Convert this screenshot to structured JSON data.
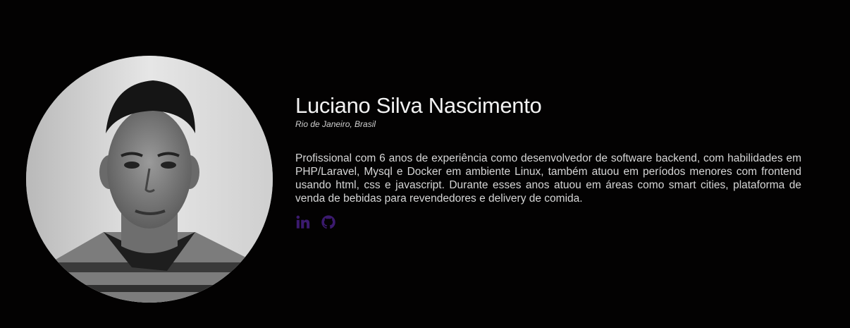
{
  "profile": {
    "name": "Luciano Silva Nascimento",
    "location": "Rio de Janeiro, Brasil",
    "bio": "Profissional com 6 anos de experiência como desenvolvedor de software backend, com habilidades em PHP/Laravel, Mysql e Docker em ambiente Linux, também atuou em períodos menores com frontend usando html, css e javascript. Durante esses anos atuou em áreas como smart cities, plataforma de venda de bebidas para revendedores e delivery de comida."
  },
  "social": [
    {
      "icon": "linkedin-icon"
    },
    {
      "icon": "github-icon"
    }
  ],
  "colors": {
    "background": "#030202",
    "icon_accent": "#3b1a6e",
    "name_text": "#f2f2f2"
  }
}
